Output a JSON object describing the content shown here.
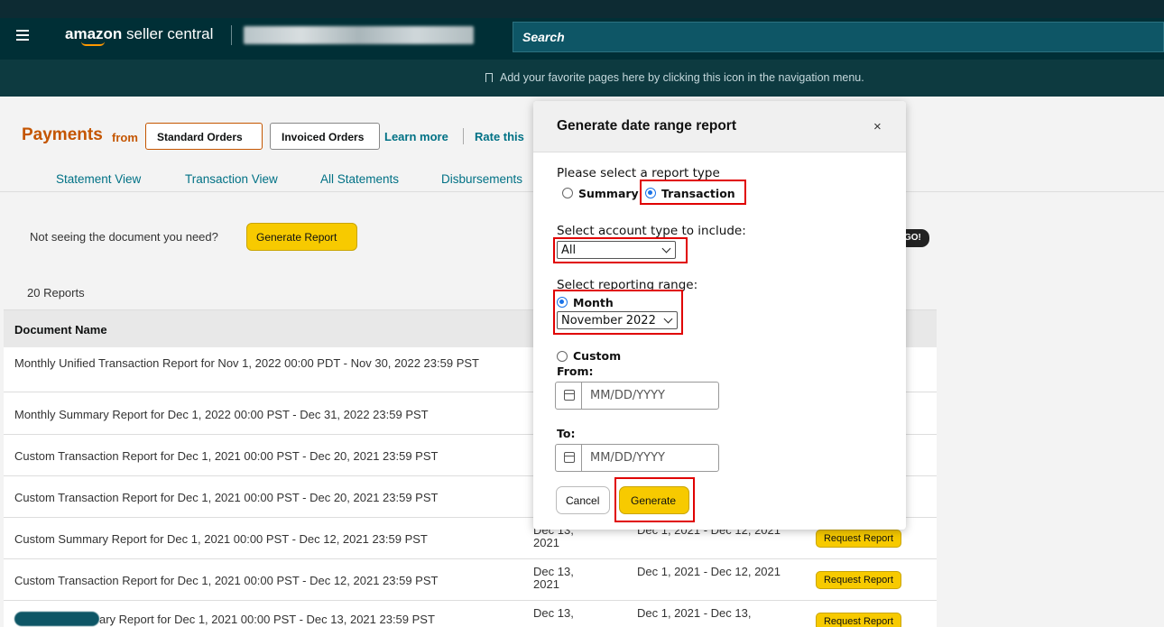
{
  "header": {
    "logo_brand": "amazon",
    "logo_product": " seller central",
    "search_placeholder": "Search",
    "favorites_hint": "Add your favorite pages here by clicking this icon in the navigation menu."
  },
  "payments": {
    "title": "Payments",
    "from_label": "from",
    "order_toggles": [
      "Standard Orders",
      "Invoiced Orders"
    ],
    "learn_more": "Learn more",
    "rate_this": "Rate this"
  },
  "subnav": {
    "tabs": [
      "Statement View",
      "Transaction View",
      "All Statements",
      "Disbursements"
    ]
  },
  "notice": {
    "text": "Not seeing the document you need?",
    "button": "Generate Report",
    "go_badge": "GO!"
  },
  "reports": {
    "count_label": "20 Reports",
    "column_document_name": "Document Name",
    "rows": [
      {
        "name": "Monthly Unified Transaction Report for Nov 1, 2022 00:00 PDT - Nov 30, 2022 23:59 PST",
        "date": "",
        "range": "",
        "action": ""
      },
      {
        "name": "Monthly Summary Report for Dec 1, 2022 00:00 PST - Dec 31, 2022 23:59 PST",
        "date": "",
        "range": "",
        "action": ""
      },
      {
        "name": "Custom Transaction Report for Dec 1, 2021 00:00 PST - Dec 20, 2021 23:59 PST",
        "date": "",
        "range": "",
        "action": ""
      },
      {
        "name": "Custom Transaction Report for Dec 1, 2021 00:00 PST - Dec 20, 2021 23:59 PST",
        "date": "",
        "range": "",
        "action": ""
      },
      {
        "name": "Custom Summary Report for Dec 1, 2021 00:00 PST - Dec 12, 2021 23:59 PST",
        "date": "Dec 13, 2021",
        "range": "Dec 1, 2021 - Dec 12, 2021",
        "action": "Request Report"
      },
      {
        "name": "Custom Transaction Report for Dec 1, 2021 00:00 PST - Dec 12, 2021 23:59 PST",
        "date": "Dec 13, 2021",
        "range": "Dec 1, 2021 - Dec 12, 2021",
        "action": "Request Report"
      },
      {
        "name": "ary Report for Dec 1, 2021 00:00 PST - Dec 13, 2021 23:59 PST",
        "date": "Dec 13,",
        "range": "Dec 1, 2021 - Dec 13,",
        "action": "Request Report"
      }
    ]
  },
  "modal": {
    "title": "Generate date range report",
    "close": "×",
    "report_type_label": "Please select a report type",
    "report_types": [
      "Summary",
      "Transaction"
    ],
    "selected_report_type": "Transaction",
    "account_type_label": "Select account type to include:",
    "account_type_value": "All",
    "reporting_range_label": "Select reporting range:",
    "range_month_label": "Month",
    "month_value": "November 2022",
    "range_custom_label": "Custom",
    "from_label": "From:",
    "to_label": "To:",
    "date_placeholder": "MM/DD/YYYY",
    "cancel": "Cancel",
    "generate": "Generate"
  },
  "colors": {
    "header_bg": "#002f36",
    "accent_orange": "#c45500",
    "link_teal": "#007185",
    "button_yellow": "#f7ca00",
    "highlight_red": "#e00000"
  }
}
